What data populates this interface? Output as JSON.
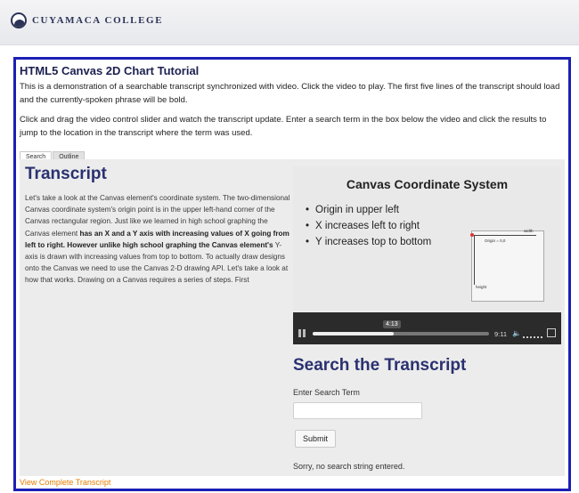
{
  "header": {
    "logo_text": "CUYAMACA COLLEGE"
  },
  "page": {
    "title": "HTML5 Canvas 2D Chart Tutorial",
    "intro_1": "This is a demonstration of a searchable transcript synchronized with video. Click the video to play. The first five lines of the transcript should load and the currently-spoken phrase will be bold.",
    "intro_2": "Click and drag the video control slider and watch the transcript update. Enter a search term in the box below the video and click the results to jump to the location in the transcript where the term was used."
  },
  "tabs": [
    {
      "label": "Search",
      "active": true
    },
    {
      "label": "Outline",
      "active": false
    }
  ],
  "transcript": {
    "heading": "Transcript",
    "text_1": "Let's take a look at the Canvas element's coordinate system. The two-dimensional Canvas coordinate system's origin point is in the upper left-hand corner of the Canvas rectangular region. Just like we learned in high school graphing the Canvas element ",
    "bold_1": "has an X and a Y axis with increasing values of X going from left to right. However unlike high school graphing the Canvas element's",
    "text_2": " Y-axis is drawn with increasing values from top to bottom. To actually draw designs onto the Canvas we need to use the Canvas 2-D drawing API. Let's take a look at how that works. Drawing on a Canvas requires a series of steps. First"
  },
  "slide": {
    "title": "Canvas Coordinate System",
    "bullets": [
      "Origin in upper left",
      "X increases left to right",
      "Y increases top to bottom"
    ],
    "diagram": {
      "origin_label": "Origin = 0,0",
      "width_label": "width",
      "height_label": "height"
    }
  },
  "video": {
    "current_time": "4:13",
    "duration": "9:11",
    "progress": 0.46
  },
  "search": {
    "heading": "Search the Transcript",
    "label": "Enter Search Term",
    "input_value": "",
    "button": "Submit",
    "status": "Sorry, no search string entered."
  },
  "footer": {
    "link": "View Complete Transcript"
  },
  "colors": {
    "panel_border": "#1b1fb5",
    "heading": "#2a3170",
    "link": "#e67e00"
  }
}
